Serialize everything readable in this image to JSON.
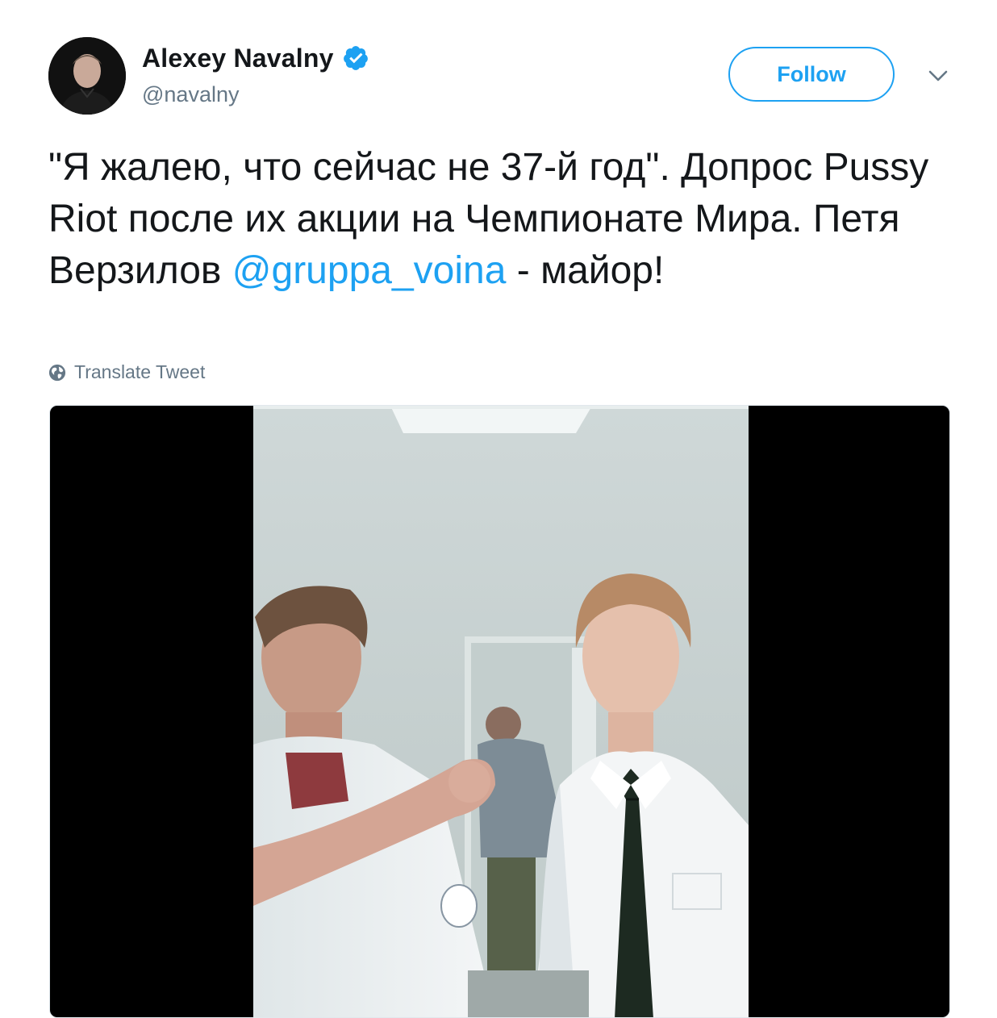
{
  "author": {
    "display_name": "Alexey Navalny",
    "handle": "@navalny",
    "verified": true,
    "avatar_icon": "profile-photo"
  },
  "actions": {
    "follow_label": "Follow",
    "menu_icon": "chevron-down-icon"
  },
  "tweet": {
    "text_part1": "\"Я жалею, что сейчас не 37-й год\". Допрос Pussy Riot после их акции на Чемпионате Мира. Петя Верзилов ",
    "mention": "@gruppa_voina",
    "text_part2": " - майор!"
  },
  "translate": {
    "label": "Translate Tweet",
    "icon": "globe-icon"
  },
  "media": {
    "type": "video",
    "description_icon": "video-thumbnail"
  },
  "colors": {
    "accent": "#1da1f2",
    "text": "#14171a",
    "secondary": "#657786"
  }
}
